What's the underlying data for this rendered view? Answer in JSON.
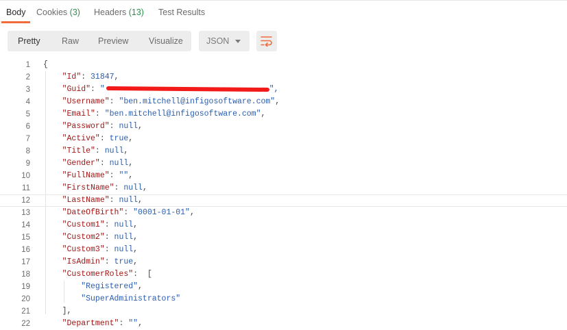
{
  "tabs": [
    {
      "label": "Body",
      "count": ""
    },
    {
      "label": "Cookies",
      "count": "(3)"
    },
    {
      "label": "Headers",
      "count": "(13)"
    },
    {
      "label": "Test Results",
      "count": ""
    }
  ],
  "view_modes": [
    "Pretty",
    "Raw",
    "Preview",
    "Visualize"
  ],
  "format": {
    "selected": "JSON"
  },
  "wrap_icon": "wrap-lines-icon",
  "colors": {
    "accent": "#f26b3a",
    "count": "#2f8f4e",
    "key": "#a31515",
    "value": "#2a5db0"
  },
  "lines": [
    {
      "num": "1",
      "key": "",
      "value": "",
      "vtype": "",
      "punct": "{"
    },
    {
      "num": "2",
      "key": "\"Id\"",
      "value": "31847",
      "vtype": "n",
      "punct": ","
    },
    {
      "num": "3",
      "key": "\"Guid\"",
      "value": "\"",
      "vtype": "redacted",
      "punct": "\","
    },
    {
      "num": "4",
      "key": "\"Username\"",
      "value": "\"ben.mitchell@infigosoftware.com\"",
      "vtype": "s",
      "punct": ","
    },
    {
      "num": "5",
      "key": "\"Email\"",
      "value": "\"ben.mitchell@infigosoftware.com\"",
      "vtype": "s",
      "punct": ","
    },
    {
      "num": "6",
      "key": "\"Password\"",
      "value": "null",
      "vtype": "n",
      "punct": ","
    },
    {
      "num": "7",
      "key": "\"Active\"",
      "value": "true",
      "vtype": "n",
      "punct": ","
    },
    {
      "num": "8",
      "key": "\"Title\"",
      "value": "null",
      "vtype": "n",
      "punct": ","
    },
    {
      "num": "9",
      "key": "\"Gender\"",
      "value": "null",
      "vtype": "n",
      "punct": ","
    },
    {
      "num": "10",
      "key": "\"FullName\"",
      "value": "\"\"",
      "vtype": "s",
      "punct": ","
    },
    {
      "num": "11",
      "key": "\"FirstName\"",
      "value": "null",
      "vtype": "n",
      "punct": ","
    },
    {
      "num": "12",
      "key": "\"LastName\"",
      "value": "null",
      "vtype": "n",
      "punct": ","
    },
    {
      "num": "13",
      "key": "\"DateOfBirth\"",
      "value": "\"0001-01-01\"",
      "vtype": "s",
      "punct": ","
    },
    {
      "num": "14",
      "key": "\"Custom1\"",
      "value": "null",
      "vtype": "n",
      "punct": ","
    },
    {
      "num": "15",
      "key": "\"Custom2\"",
      "value": "null",
      "vtype": "n",
      "punct": ","
    },
    {
      "num": "16",
      "key": "\"Custom3\"",
      "value": "null",
      "vtype": "n",
      "punct": ","
    },
    {
      "num": "17",
      "key": "\"IsAdmin\"",
      "value": "true",
      "vtype": "n",
      "punct": ","
    },
    {
      "num": "18",
      "key": "\"CustomerRoles\"",
      "value": "",
      "vtype": "",
      "punct": " ["
    },
    {
      "num": "19",
      "key": "",
      "value": "\"Registered\"",
      "vtype": "s",
      "punct": ","
    },
    {
      "num": "20",
      "key": "",
      "value": "\"SuperAdministrators\"",
      "vtype": "s",
      "punct": ""
    },
    {
      "num": "21",
      "key": "",
      "value": "",
      "vtype": "",
      "punct": "],"
    },
    {
      "num": "22",
      "key": "\"Department\"",
      "value": "\"\"",
      "vtype": "s",
      "punct": ","
    }
  ]
}
